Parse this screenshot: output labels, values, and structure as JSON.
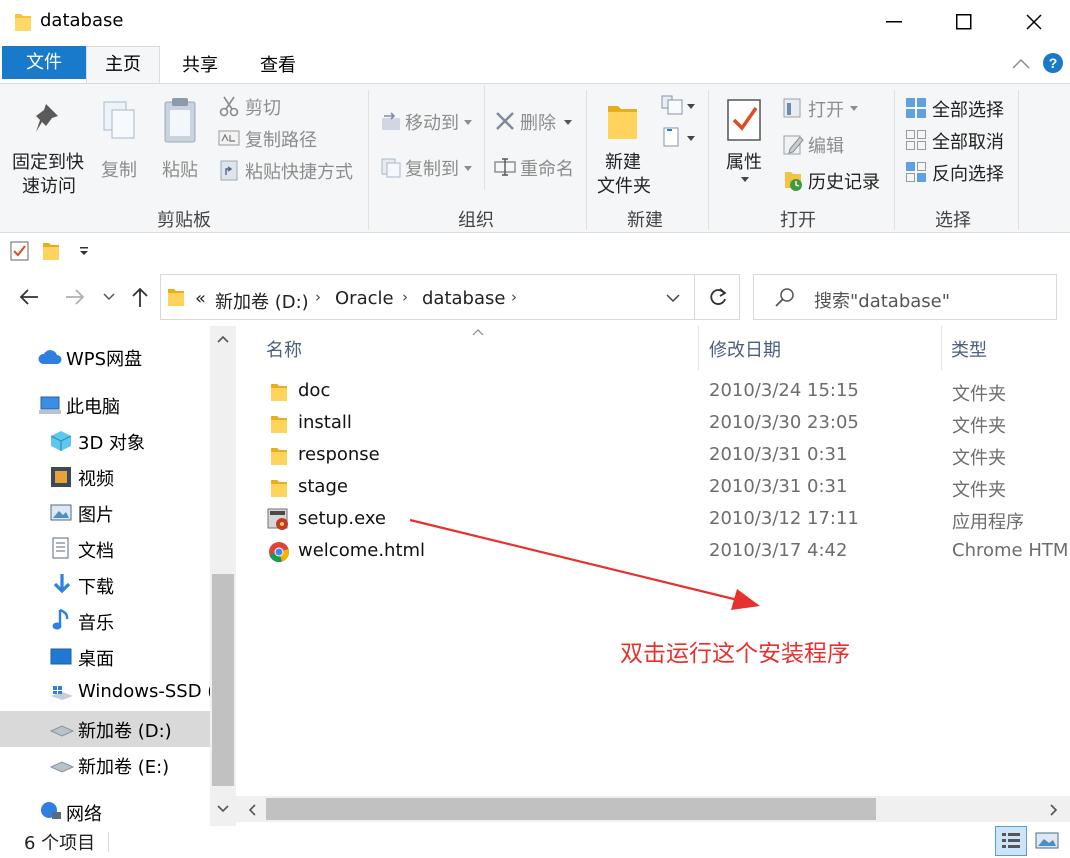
{
  "window": {
    "title": "database"
  },
  "ribbon_tabs": [
    {
      "label": "文件"
    },
    {
      "label": "主页"
    },
    {
      "label": "共享"
    },
    {
      "label": "查看"
    }
  ],
  "clipboard": {
    "pin": "固定到快速访问",
    "pin_line1": "固定到快",
    "pin_line2": "速访问",
    "copy": "复制",
    "paste": "粘贴",
    "cut": "剪切",
    "copy_path": "复制路径",
    "paste_shortcut": "粘贴快捷方式",
    "group": "剪贴板"
  },
  "organize": {
    "move_to": "移动到",
    "copy_to": "复制到",
    "delete": "删除",
    "rename": "重命名",
    "group": "组织"
  },
  "new_group": {
    "new_folder_line1": "新建",
    "new_folder_line2": "文件夹",
    "group": "新建"
  },
  "open_group": {
    "properties": "属性",
    "open": "打开",
    "edit": "编辑",
    "history": "历史记录",
    "group": "打开"
  },
  "select_group": {
    "select_all": "全部选择",
    "select_none": "全部取消",
    "invert": "反向选择",
    "group": "选择"
  },
  "address": {
    "overflow": "«",
    "crumbs": [
      "新加卷 (D:)",
      "Oracle",
      "database"
    ]
  },
  "search": {
    "placeholder": "搜索\"database\""
  },
  "nav": {
    "items": [
      {
        "label": "WPS网盘"
      },
      {
        "label": "此电脑"
      },
      {
        "label": "3D 对象"
      },
      {
        "label": "视频"
      },
      {
        "label": "图片"
      },
      {
        "label": "文档"
      },
      {
        "label": "下载"
      },
      {
        "label": "音乐"
      },
      {
        "label": "桌面"
      },
      {
        "label": "Windows-SSD ("
      },
      {
        "label": "新加卷 (D:)"
      },
      {
        "label": "新加卷 (E:)"
      },
      {
        "label": "网络"
      }
    ]
  },
  "columns": {
    "name": "名称",
    "date": "修改日期",
    "type": "类型"
  },
  "files": [
    {
      "name": "doc",
      "date": "2010/3/24 15:15",
      "type": "文件夹",
      "icon": "folder-icon"
    },
    {
      "name": "install",
      "date": "2010/3/30 23:05",
      "type": "文件夹",
      "icon": "folder-icon"
    },
    {
      "name": "response",
      "date": "2010/3/31 0:31",
      "type": "文件夹",
      "icon": "folder-icon"
    },
    {
      "name": "stage",
      "date": "2010/3/31 0:31",
      "type": "文件夹",
      "icon": "folder-icon"
    },
    {
      "name": "setup.exe",
      "date": "2010/3/12 17:11",
      "type": "应用程序",
      "icon": "installer-icon"
    },
    {
      "name": "welcome.html",
      "date": "2010/3/17 4:42",
      "type": "Chrome HTML",
      "icon": "chrome-icon"
    }
  ],
  "annotation": {
    "text": "双击运行这个安装程序",
    "color": "#e8312d"
  },
  "status": {
    "count": "6 个项目"
  },
  "colors": {
    "accent": "#1979ca",
    "ribbon_bg": "#f5f6f7",
    "folder": "#f5c342"
  }
}
